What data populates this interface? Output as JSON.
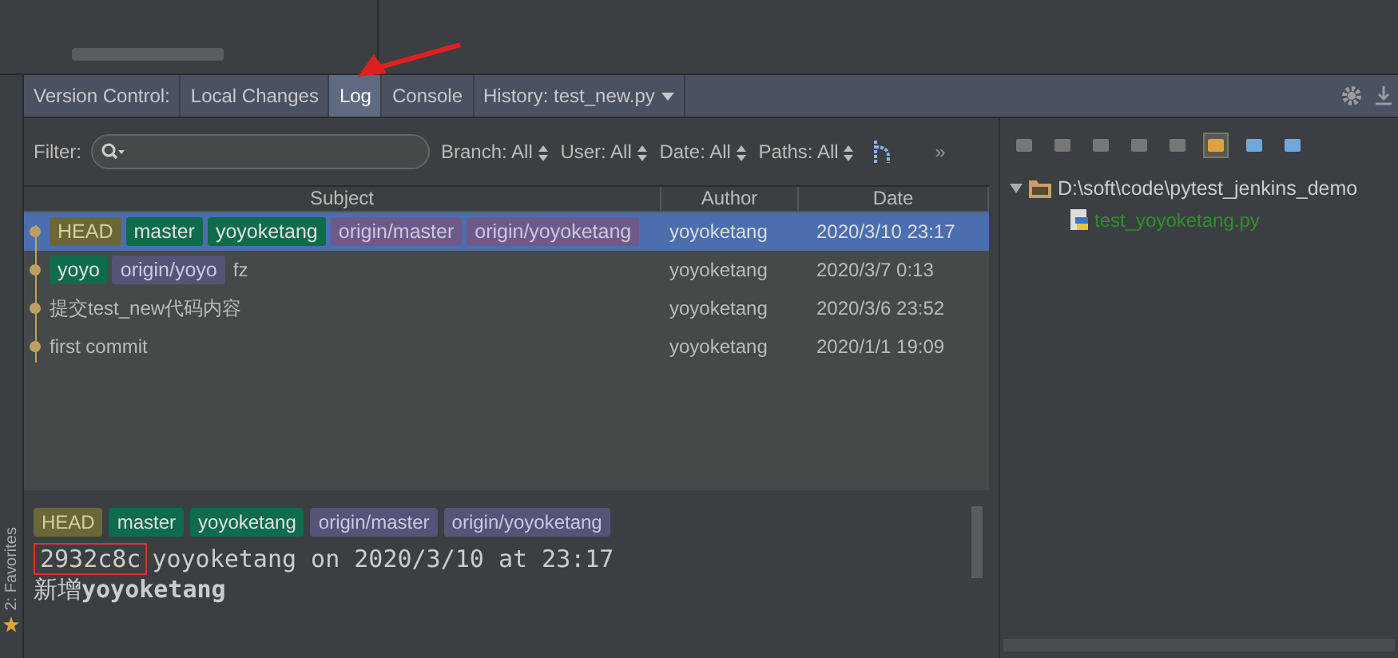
{
  "tool_window": {
    "label": "Version Control:",
    "tabs": [
      {
        "label": "Local Changes",
        "selected": false
      },
      {
        "label": "Log",
        "selected": true
      },
      {
        "label": "Console",
        "selected": false
      },
      {
        "label": "History: test_new.py",
        "selected": false,
        "dropdown": true
      }
    ]
  },
  "filter": {
    "label": "Filter:"
  },
  "filters": [
    "Branch: All",
    "User: All",
    "Date: All",
    "Paths: All"
  ],
  "more": "»",
  "table": {
    "columns": [
      "Subject",
      "Author",
      "Date"
    ],
    "rows": [
      {
        "selected": true,
        "refs": [
          {
            "label": "HEAD",
            "kind": "head"
          },
          {
            "label": "master",
            "kind": "local"
          },
          {
            "label": "yoyoketang",
            "kind": "local"
          },
          {
            "label": "origin/master",
            "kind": "remote"
          },
          {
            "label": "origin/yoyoketang",
            "kind": "remote"
          }
        ],
        "subject": "",
        "author": "yoyoketang",
        "date": "2020/3/10 23:17"
      },
      {
        "selected": false,
        "refs": [
          {
            "label": "yoyo",
            "kind": "local"
          },
          {
            "label": "origin/yoyo",
            "kind": "remote"
          }
        ],
        "subject": "fz",
        "author": "yoyoketang",
        "date": "2020/3/7 0:13"
      },
      {
        "selected": false,
        "refs": [],
        "subject": "提交test_new代码内容",
        "author": "yoyoketang",
        "date": "2020/3/6 23:52"
      },
      {
        "selected": false,
        "refs": [],
        "subject": "first commit",
        "author": "yoyoketang",
        "date": "2020/1/1 19:09"
      }
    ]
  },
  "details": {
    "refs": [
      {
        "label": "HEAD",
        "kind": "head"
      },
      {
        "label": "master",
        "kind": "local"
      },
      {
        "label": "yoyoketang",
        "kind": "local"
      },
      {
        "label": "origin/master",
        "kind": "remote"
      },
      {
        "label": "origin/yoyoketang",
        "kind": "remote"
      }
    ],
    "hash": "2932c8c",
    "meta": "yoyoketang on 2020/3/10 at 23:17",
    "message": "新增**yoyoketang**"
  },
  "changes": {
    "root": {
      "label": "D:\\soft\\code\\pytest_jenkins_demo",
      "expanded": true
    },
    "files": [
      "test_yoyoketang.py"
    ]
  },
  "side_tab": "2: Favorites"
}
